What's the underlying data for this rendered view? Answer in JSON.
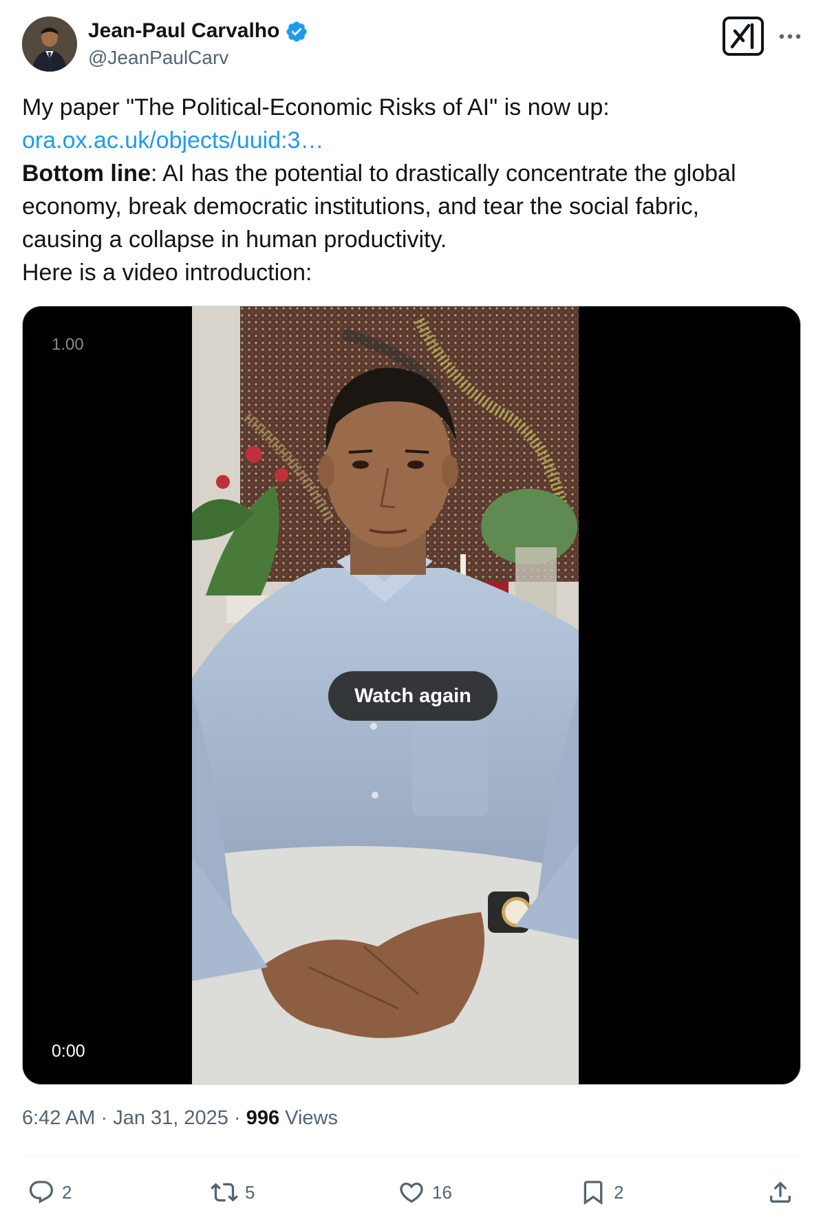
{
  "author": {
    "name": "Jean-Paul Carvalho",
    "handle": "@JeanPaulCarv",
    "verified": true
  },
  "icons": {
    "verified": "verified-badge-icon",
    "grok": "grok-icon",
    "more": "more-options-icon",
    "reply": "reply-icon",
    "repost": "repost-icon",
    "like": "like-icon",
    "bookmark": "bookmark-icon",
    "share": "share-icon"
  },
  "colors": {
    "link": "#1d9bf0",
    "verified": "#1d9bf0",
    "secondary_text": "#536471",
    "primary_text": "#0f1419"
  },
  "tweet": {
    "line1": "My paper \"The Political-Economic Risks of AI\" is now up:",
    "link": "ora.ox.ac.uk/objects/uuid:3…",
    "bottom_label": "Bottom line",
    "line3_rest": ": AI has the potential to drastically concentrate the global",
    "line4": "economy, break democratic institutions, and tear the social fabric,",
    "line5": "causing a collapse in human productivity.",
    "line6": "Here is a video introduction:"
  },
  "video": {
    "playback_speed": "1.00",
    "time": "0:00",
    "watch_again_label": "Watch again"
  },
  "meta": {
    "time": "6:42 AM",
    "separator": "·",
    "date": "Jan 31, 2025",
    "views_count": "996",
    "views_label": "Views"
  },
  "actions": {
    "replies": "2",
    "reposts": "5",
    "likes": "16",
    "bookmarks": "2"
  }
}
